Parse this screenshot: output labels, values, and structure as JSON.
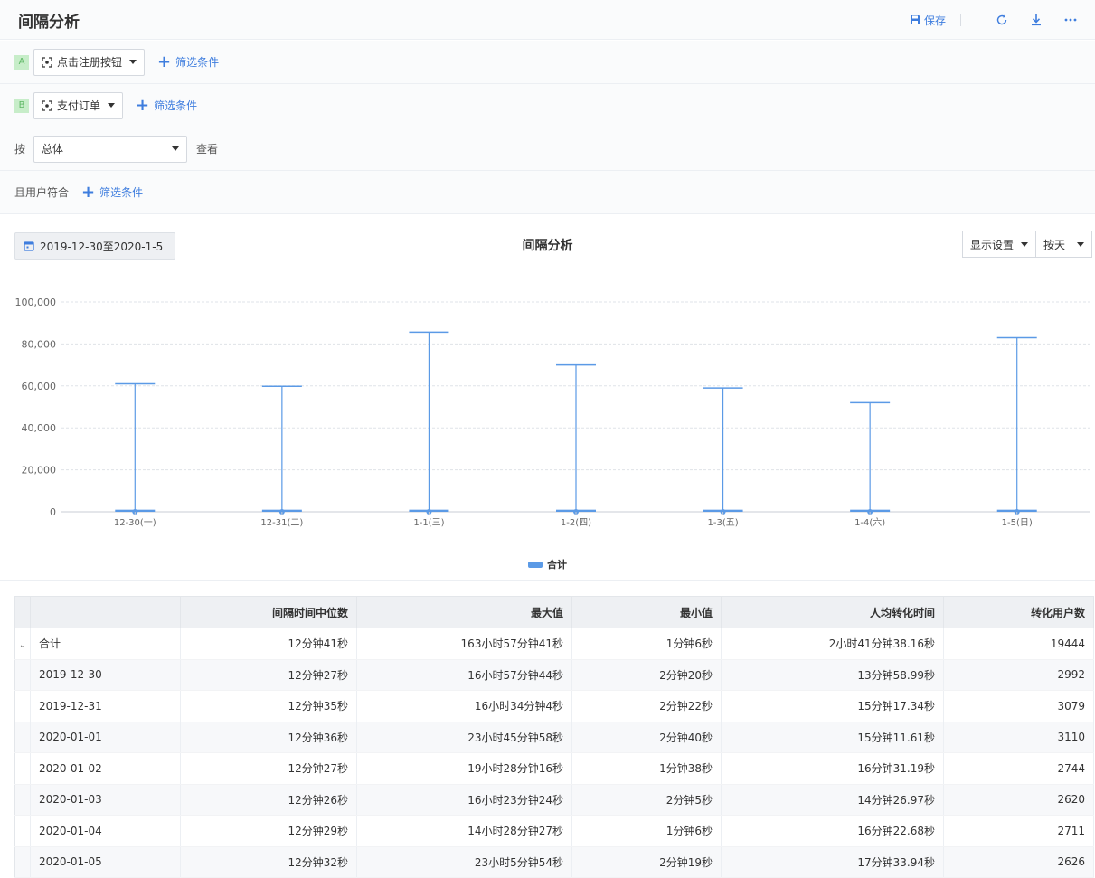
{
  "header": {
    "title": "间隔分析",
    "save_label": "保存"
  },
  "icons": [
    "save-icon",
    "refresh-icon",
    "download-icon",
    "more-icon",
    "event-icon",
    "calendar-icon",
    "plus-icon",
    "chevron-down-icon"
  ],
  "steps": [
    {
      "badge": "A",
      "event": "点击注册按钮",
      "add_filter": "筛选条件"
    },
    {
      "badge": "B",
      "event": "支付订单",
      "add_filter": "筛选条件"
    }
  ],
  "group_by": {
    "prefix": "按",
    "value": "总体",
    "suffix": "查看"
  },
  "user_filter": {
    "label": "且用户符合",
    "add_filter": "筛选条件"
  },
  "chart_panel": {
    "date_range": "2019-12-30至2020-1-5",
    "display_settings": "显示设置",
    "granularity": "按天"
  },
  "colors": {
    "accent": "#3e7dde",
    "series": "#5b9ae6",
    "badge_bg": "#c7edc9",
    "badge_text": "#5fb866"
  },
  "chart_data": {
    "type": "boxplot",
    "title": "间隔分析",
    "categories": [
      "12-30(一)",
      "12-31(二)",
      "1-1(三)",
      "1-2(四)",
      "1-3(五)",
      "1-4(六)",
      "1-5(日)"
    ],
    "series": [
      {
        "name": "合计",
        "max": [
          61000,
          59800,
          85600,
          70000,
          59000,
          52000,
          83000
        ],
        "box_upper": [
          1000,
          1000,
          1000,
          1000,
          1000,
          1000,
          1000
        ],
        "min": [
          0,
          0,
          0,
          0,
          0,
          0,
          0
        ],
        "median": [
          0,
          0,
          0,
          0,
          0,
          0,
          0
        ]
      }
    ],
    "ylim": [
      0,
      100000
    ],
    "yticks": [
      "0",
      "20,000",
      "40,000",
      "60,000",
      "80,000",
      "100,000"
    ],
    "yticks_values": [
      0,
      20000,
      40000,
      60000,
      80000,
      100000
    ],
    "grid": true,
    "legend": "bottom"
  },
  "table": {
    "columns": [
      "",
      "间隔时间中位数",
      "最大值",
      "最小值",
      "人均转化时间",
      "转化用户数"
    ],
    "rows": [
      [
        "合计",
        "12分钟41秒",
        "163小时57分钟41秒",
        "1分钟6秒",
        "2小时41分钟38.16秒",
        "19444"
      ],
      [
        "2019-12-30",
        "12分钟27秒",
        "16小时57分钟44秒",
        "2分钟20秒",
        "13分钟58.99秒",
        "2992"
      ],
      [
        "2019-12-31",
        "12分钟35秒",
        "16小时34分钟4秒",
        "2分钟22秒",
        "15分钟17.34秒",
        "3079"
      ],
      [
        "2020-01-01",
        "12分钟36秒",
        "23小时45分钟58秒",
        "2分钟40秒",
        "15分钟11.61秒",
        "3110"
      ],
      [
        "2020-01-02",
        "12分钟27秒",
        "19小时28分钟16秒",
        "1分钟38秒",
        "16分钟31.19秒",
        "2744"
      ],
      [
        "2020-01-03",
        "12分钟26秒",
        "16小时23分钟24秒",
        "2分钟5秒",
        "14分钟26.97秒",
        "2620"
      ],
      [
        "2020-01-04",
        "12分钟29秒",
        "14小时28分钟27秒",
        "1分钟6秒",
        "16分钟22.68秒",
        "2711"
      ],
      [
        "2020-01-05",
        "12分钟32秒",
        "23小时5分钟54秒",
        "2分钟19秒",
        "17分钟33.94秒",
        "2626"
      ]
    ]
  }
}
